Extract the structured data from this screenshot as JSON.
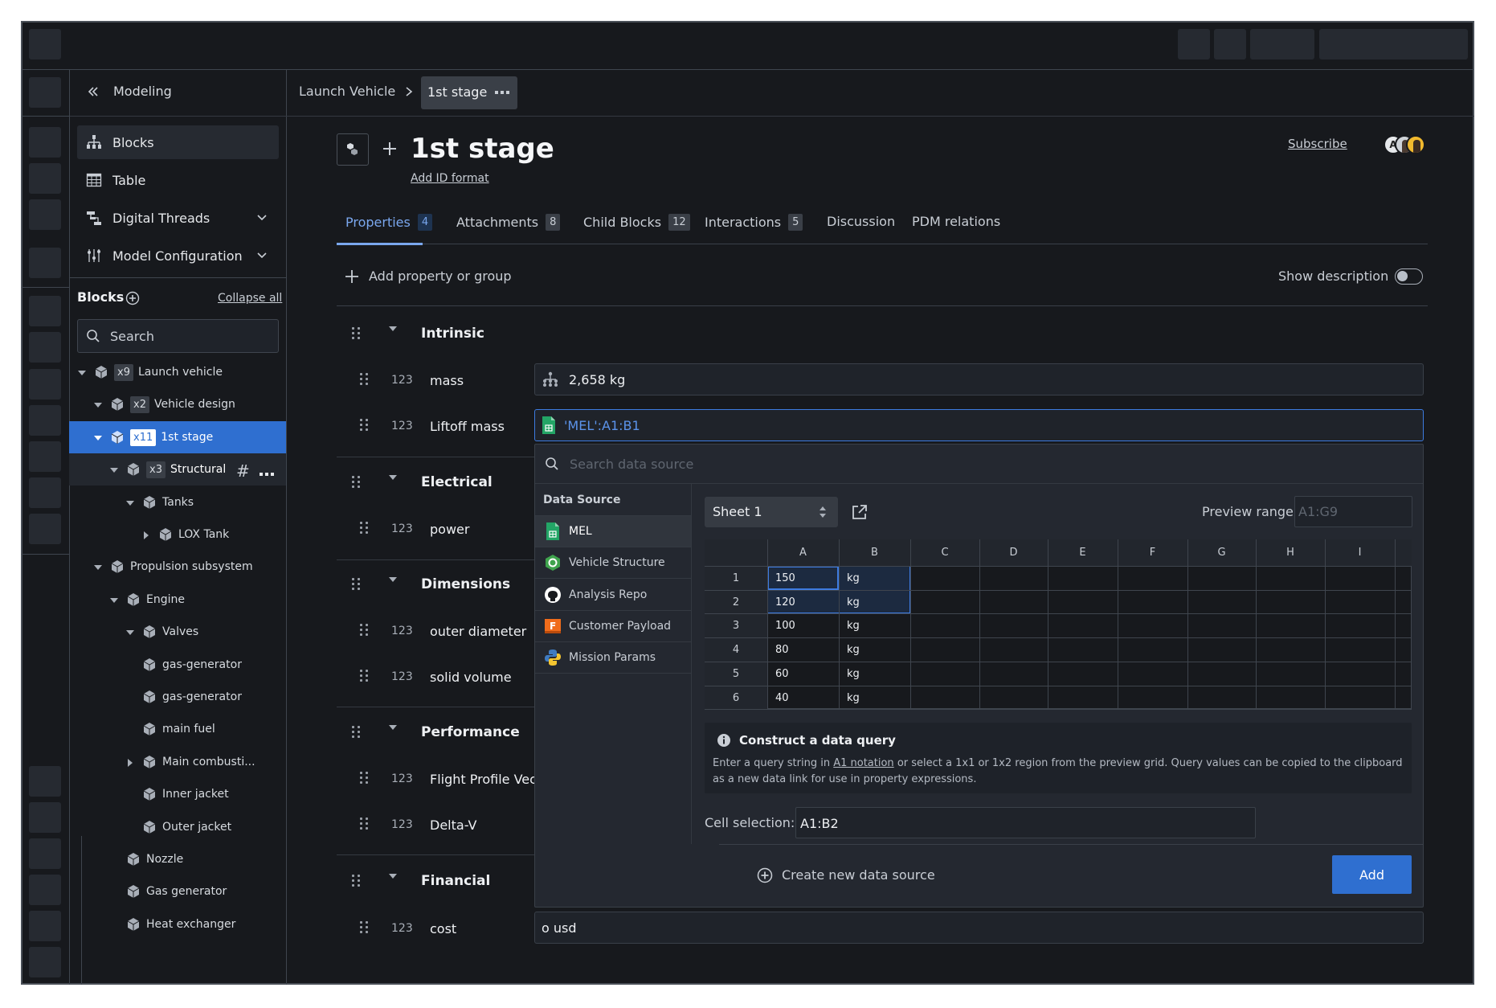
{
  "app": {
    "module_title": "Modeling"
  },
  "nav": {
    "items": [
      {
        "label": "Blocks",
        "icon": "hierarchy-icon",
        "active": true
      },
      {
        "label": "Table",
        "icon": "table-icon"
      },
      {
        "label": "Digital Threads",
        "icon": "digital-threads-icon",
        "expandable": true
      },
      {
        "label": "Model Configuration",
        "icon": "sliders-icon",
        "expandable": true
      }
    ]
  },
  "blocks_panel": {
    "title": "Blocks",
    "collapse_all": "Collapse all",
    "search_placeholder": "Search",
    "tree": [
      {
        "label": "Launch vehicle",
        "badge": "x9",
        "depth": 0,
        "caret": "down"
      },
      {
        "label": "Vehicle design",
        "badge": "x2",
        "depth": 1,
        "caret": "down"
      },
      {
        "label": "1st stage",
        "badge": "x11",
        "depth": 1,
        "caret": "down",
        "selected": true
      },
      {
        "label": "Structural",
        "badge": "x3",
        "depth": 2,
        "caret": "down",
        "hover": true
      },
      {
        "label": "Tanks",
        "badge": "",
        "depth": 3,
        "caret": "down"
      },
      {
        "label": "LOX Tank",
        "badge": "",
        "depth": 4,
        "caret": "right"
      },
      {
        "label": "Propulsion subsystem",
        "badge": "",
        "depth": 1,
        "caret": "down"
      },
      {
        "label": "Engine",
        "badge": "",
        "depth": 2,
        "caret": "down"
      },
      {
        "label": "Valves",
        "badge": "",
        "depth": 3,
        "caret": "down"
      },
      {
        "label": "gas-generator",
        "badge": "",
        "depth": 3,
        "caret": ""
      },
      {
        "label": "gas-generator",
        "badge": "",
        "depth": 3,
        "caret": ""
      },
      {
        "label": "main fuel",
        "badge": "",
        "depth": 3,
        "caret": ""
      },
      {
        "label": "Main combusti...",
        "badge": "",
        "depth": 3,
        "caret": "right"
      },
      {
        "label": "Inner jacket",
        "badge": "",
        "depth": 3,
        "caret": ""
      },
      {
        "label": "Outer jacket",
        "badge": "",
        "depth": 3,
        "caret": ""
      },
      {
        "label": "Nozzle",
        "badge": "",
        "depth": 2,
        "caret": ""
      },
      {
        "label": "Gas generator",
        "badge": "",
        "depth": 2,
        "caret": ""
      },
      {
        "label": "Heat exchanger",
        "badge": "",
        "depth": 2,
        "caret": ""
      }
    ]
  },
  "breadcrumb": {
    "parent": "Launch Vehicle",
    "current": "1st stage"
  },
  "header": {
    "title": "1st stage",
    "add_id_format": "Add ID format",
    "subscribe": "Subscribe",
    "avatar_initial": "A"
  },
  "tabs": [
    {
      "label": "Properties",
      "count": "4",
      "active": true
    },
    {
      "label": "Attachments",
      "count": "8"
    },
    {
      "label": "Child Blocks",
      "count": "12"
    },
    {
      "label": "Interactions",
      "count": "5"
    },
    {
      "label": "Discussion",
      "count": ""
    },
    {
      "label": "PDM relations",
      "count": ""
    }
  ],
  "toolbar": {
    "add_property": "Add property or group",
    "show_description": "Show description",
    "show_description_on": false
  },
  "groups": [
    {
      "label": "Intrinsic",
      "properties": [
        {
          "type": "123",
          "name": "mass",
          "value": "2,658 kg"
        },
        {
          "type": "123",
          "name": "Liftoff mass",
          "value": "'MEL':A1:B1"
        }
      ]
    },
    {
      "label": "Electrical",
      "properties": [
        {
          "type": "123",
          "name": "power",
          "value": ""
        }
      ]
    },
    {
      "label": "Dimensions",
      "properties": [
        {
          "type": "123",
          "name": "outer diameter",
          "value": ""
        },
        {
          "type": "123",
          "name": "solid volume",
          "value": ""
        }
      ]
    },
    {
      "label": "Performance",
      "properties": [
        {
          "type": "123",
          "name": "Flight Profile Vec",
          "value": ""
        },
        {
          "type": "123",
          "name": "Delta-V",
          "value": ""
        }
      ]
    },
    {
      "label": "Financial",
      "properties": [
        {
          "type": "123",
          "name": "cost",
          "value": "o usd"
        }
      ]
    }
  ],
  "datasource_picker": {
    "search_placeholder": "Search data source",
    "list_header": "Data Source",
    "sources": [
      {
        "label": "MEL",
        "icon": "google-sheets-icon",
        "active": true
      },
      {
        "label": "Vehicle Structure",
        "icon": "onshape-icon"
      },
      {
        "label": "Analysis Repo",
        "icon": "github-icon"
      },
      {
        "label": "Customer Payload",
        "icon": "fusion-icon"
      },
      {
        "label": "Mission Params",
        "icon": "python-icon"
      }
    ],
    "sheet_select": "Sheet 1",
    "preview_range_label": "Preview range",
    "preview_range_placeholder": "A1:G9",
    "grid": {
      "columns": [
        "A",
        "B",
        "C",
        "D",
        "E",
        "F",
        "G",
        "H",
        "I"
      ],
      "rows": [
        {
          "n": "1",
          "cells": [
            "150",
            "kg"
          ]
        },
        {
          "n": "2",
          "cells": [
            "120",
            "kg"
          ]
        },
        {
          "n": "3",
          "cells": [
            "100",
            "kg"
          ]
        },
        {
          "n": "4",
          "cells": [
            "80",
            "kg"
          ]
        },
        {
          "n": "5",
          "cells": [
            "60",
            "kg"
          ]
        },
        {
          "n": "6",
          "cells": [
            "40",
            "kg"
          ]
        }
      ],
      "selection": "A1:B2"
    },
    "query_help": {
      "title": "Construct a data query",
      "text_before": "Enter a query string in ",
      "link": "A1 notation",
      "text_after": " or select a 1x1 or 1x2 region from the preview grid. Query values can be copied to the clipboard as a new data link for use in property expressions."
    },
    "cell_selection_label": "Cell selection:",
    "cell_selection_value": "A1:B2",
    "create_new": "Create new data source",
    "add_button": "Add"
  },
  "colors": {
    "accent": "#2f6fd0",
    "tab_active": "#7aa7ee",
    "background": "#17191d",
    "panel": "#242830"
  }
}
